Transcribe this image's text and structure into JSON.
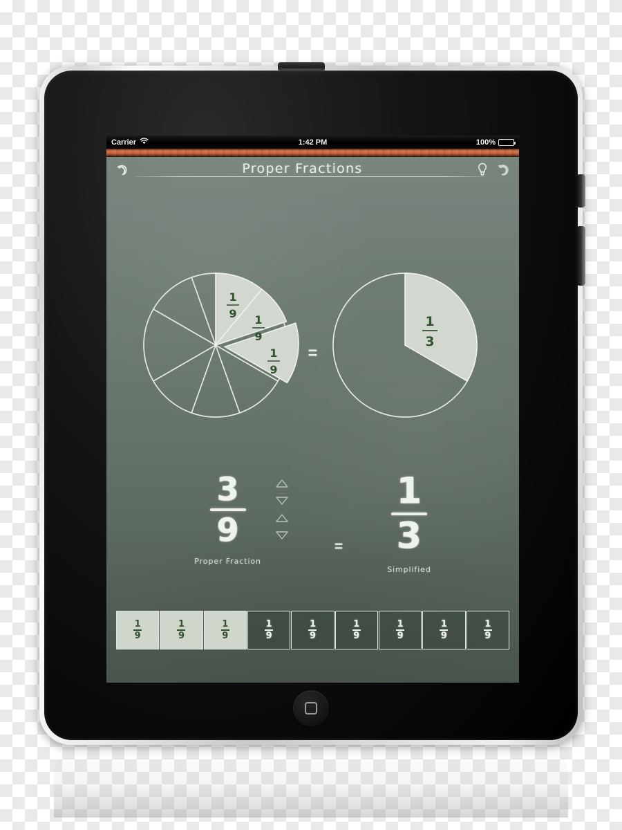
{
  "device": {
    "name": "iPad",
    "power_button": "power-button",
    "lock_switch": "screen-lock-switch",
    "volume_rocker": "volume-rocker",
    "home_button": "home-button"
  },
  "status_bar": {
    "carrier": "Carrier",
    "wifi_icon": "wifi-icon",
    "time": "1:42 PM",
    "battery_percent": "100%",
    "battery_icon": "battery-full-icon"
  },
  "title_bar": {
    "back_icon": "back-arrow-icon",
    "title": "Proper Fractions",
    "hint_icon": "lightbulb-icon",
    "reset_icon": "reset-arrow-icon"
  },
  "equals_symbol": "=",
  "pies": {
    "left": {
      "label": "proper-fraction-pie",
      "slice_labels": [
        "1",
        "9"
      ],
      "slice_text_numerator": "1",
      "slice_text_denominator": "9",
      "filled_labels": [
        "1/9",
        "1/9",
        "1/9"
      ]
    },
    "right": {
      "label": "simplified-pie",
      "slice_text_numerator": "1",
      "slice_text_denominator": "3"
    }
  },
  "fractions": {
    "proper": {
      "numerator": "3",
      "denominator": "9",
      "caption": "Proper Fraction",
      "numerator_up": "△",
      "numerator_down": "▽",
      "denominator_up": "△",
      "denominator_down": "▽"
    },
    "simplified": {
      "numerator": "1",
      "denominator": "3",
      "caption": "Simplified"
    }
  },
  "tiles": [
    {
      "numerator": "1",
      "denominator": "9",
      "state": "filled"
    },
    {
      "numerator": "1",
      "denominator": "9",
      "state": "filled"
    },
    {
      "numerator": "1",
      "denominator": "9",
      "state": "filled"
    },
    {
      "numerator": "1",
      "denominator": "9",
      "state": "empty"
    },
    {
      "numerator": "1",
      "denominator": "9",
      "state": "empty"
    },
    {
      "numerator": "1",
      "denominator": "9",
      "state": "empty"
    },
    {
      "numerator": "1",
      "denominator": "9",
      "state": "empty"
    },
    {
      "numerator": "1",
      "denominator": "9",
      "state": "empty"
    },
    {
      "numerator": "1",
      "denominator": "9",
      "state": "empty"
    }
  ],
  "colors": {
    "chalkboard_top": "#7b877c",
    "chalkboard_bottom": "#49544b",
    "chalk": "#eef3ee",
    "slice_fill": "#d2d8cf",
    "slice_text": "#31512f",
    "wood_ledge": "#c9663c"
  },
  "chart_data": [
    {
      "type": "pie",
      "title": "Proper Fraction",
      "total_slices": 9,
      "slice_value": "1/9",
      "categories": [
        "1/9",
        "1/9",
        "1/9",
        "1/9",
        "1/9",
        "1/9",
        "1/9",
        "1/9",
        "1/9"
      ],
      "values": [
        11.11,
        11.11,
        11.11,
        11.11,
        11.11,
        11.11,
        11.11,
        11.11,
        11.11
      ],
      "filled_count": 3,
      "filled_indices": [
        0,
        1,
        2
      ],
      "exploded_indices": [
        2
      ],
      "start_angle_deg": 0,
      "direction": "clockwise",
      "labels_shown": [
        "1/9",
        "1/9",
        "1/9"
      ],
      "legend": "none"
    },
    {
      "type": "pie",
      "title": "Simplified",
      "total_slices": 3,
      "slice_value": "1/3",
      "categories": [
        "1/3",
        "2/3"
      ],
      "values": [
        33.33,
        66.67
      ],
      "filled_count": 1,
      "filled_indices": [
        0
      ],
      "exploded_indices": [],
      "start_angle_deg": 0,
      "direction": "clockwise",
      "labels_shown": [
        "1/3"
      ],
      "legend": "none"
    }
  ]
}
